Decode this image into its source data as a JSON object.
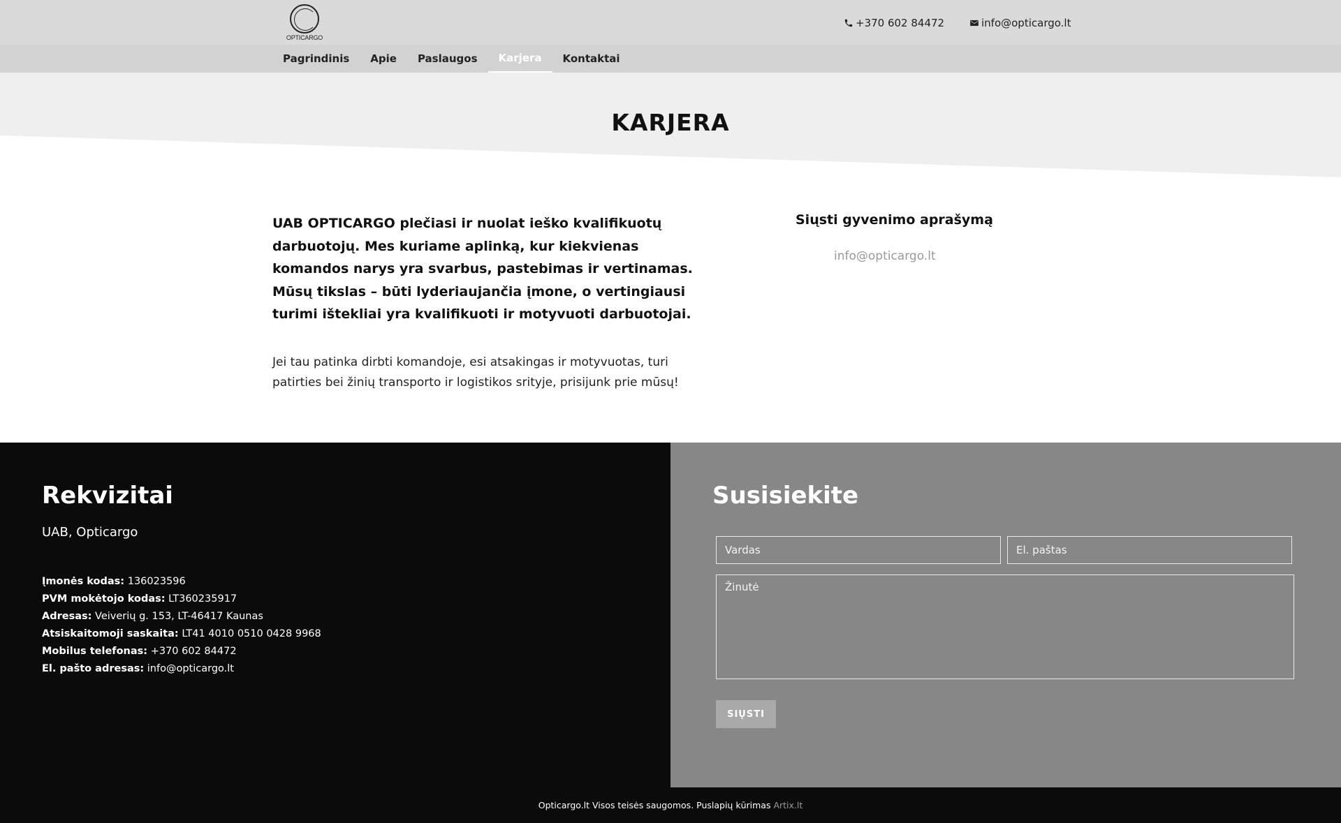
{
  "header": {
    "logo_text": "OPTICARGO",
    "phone": "+370 602 84472",
    "email": "info@opticargo.lt"
  },
  "nav": {
    "items": [
      {
        "label": "Pagrindinis"
      },
      {
        "label": "Apie"
      },
      {
        "label": "Paslaugos"
      },
      {
        "label": "Karjera",
        "active": true
      },
      {
        "label": "Kontaktai"
      }
    ]
  },
  "hero": {
    "title": "KARJERA"
  },
  "content": {
    "intro": "UAB OPTICARGO plečiasi ir nuolat ieško kvalifikuotų darbuotojų. Mes kuriame aplinką, kur kiekvienas komandos narys yra svarbus, pastebimas ir vertinamas. Mūsų tikslas – būti lyderiaujančia įmone, o vertingiausi turimi ištekliai yra kvalifikuoti ir motyvuoti darbuotojai.",
    "body": "Jei tau patinka dirbti komandoje, esi atsakingas ir motyvuotas, turi patirties bei žinių transporto ir logistikos srityje, prisijunk prie mūsų!",
    "cv_heading": "Siųsti gyvenimo aprašymą",
    "cv_email": "info@opticargo.lt"
  },
  "footer": {
    "requisites_title": "Rekvizitai",
    "company": "UAB, Opticargo",
    "requisites": [
      {
        "label": "Įmonės kodas:",
        "value": "136023596"
      },
      {
        "label": "PVM mokėtojo kodas:",
        "value": "LT360235917"
      },
      {
        "label": "Adresas:",
        "value": "Veiverių g. 153, LT-46417 Kaunas"
      },
      {
        "label": "Atsiskaitomoji saskaita:",
        "value": "LT41 4010 0510 0428 9968"
      },
      {
        "label": "Mobilus telefonas:",
        "value": "+370 602 84472"
      },
      {
        "label": "El. pašto adresas:",
        "value": "info@opticargo.lt"
      }
    ],
    "contact_title": "Susisiekite",
    "form": {
      "name_placeholder": "Vardas",
      "email_placeholder": "El. paštas",
      "message_placeholder": "Žinutė",
      "send_label": "SIŲSTI"
    },
    "copyright": "Opticargo.lt Visos teisės saugomos. Puslapių kūrimas",
    "credit_link": "Artix.lt"
  },
  "colors": {
    "topbar": "#dadada",
    "navbar": "#d2d2d2",
    "footer_dark": "#0b0b0b",
    "footer_gray": "#878787"
  }
}
